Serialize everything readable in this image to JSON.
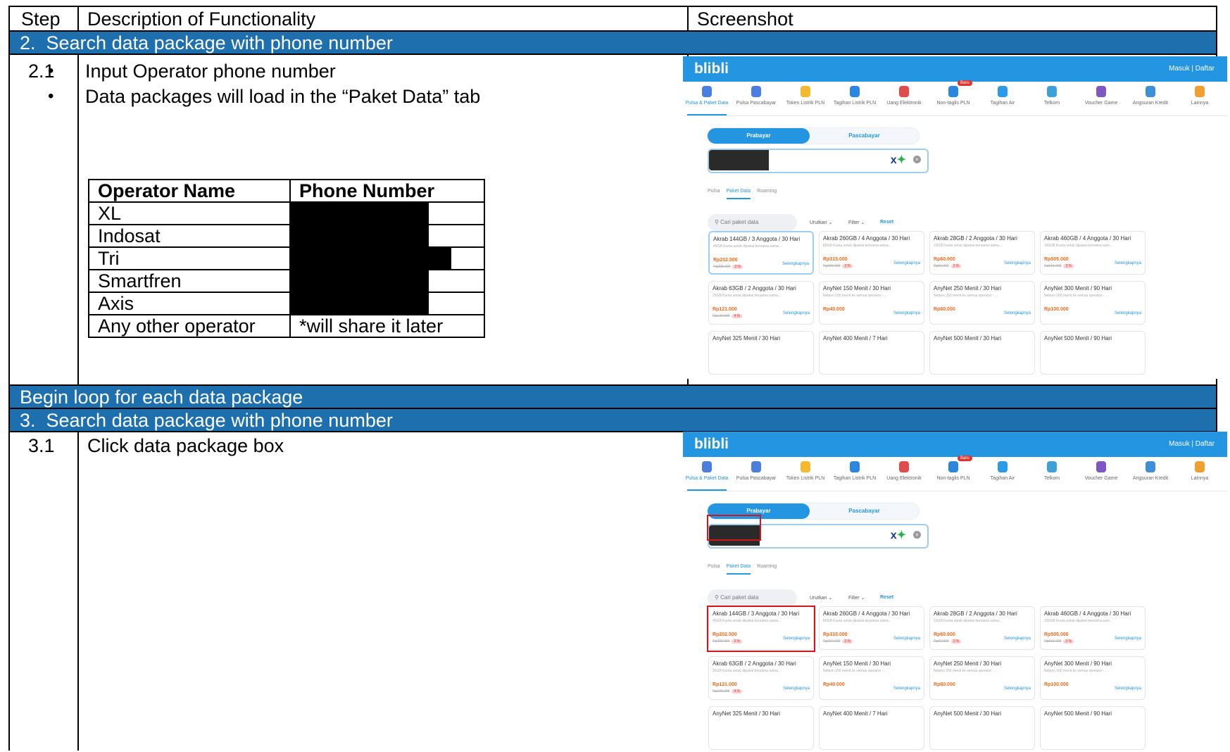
{
  "header": {
    "step": "Step",
    "description": "Description of Functionality",
    "screenshot": "Screenshot"
  },
  "section2": {
    "title": "2.  Search data package with phone number"
  },
  "step21": {
    "num": "2.1",
    "bullets": [
      "Input Operator phone number",
      "Data packages will load in the “Paket Data” tab"
    ],
    "table": {
      "headers": [
        "Operator Name",
        "Phone Number"
      ],
      "rows": [
        {
          "name": "XL",
          "phone": ""
        },
        {
          "name": "Indosat",
          "phone": ""
        },
        {
          "name": "Tri",
          "phone": ""
        },
        {
          "name": "Smartfren",
          "phone": ""
        },
        {
          "name": "Axis",
          "phone": ""
        },
        {
          "name": "Any other operator",
          "phone": "*will share it later"
        }
      ]
    }
  },
  "loop": {
    "title": "Begin loop for each data package"
  },
  "section3": {
    "title": "3.  Search data package with phone number"
  },
  "step31": {
    "num": "3.1",
    "text": "Click data package box"
  },
  "app": {
    "logo": "blibli",
    "login": "Masuk | Daftar",
    "categories": [
      {
        "label": "Pulsa & Paket Data",
        "color": "#4a7fe0"
      },
      {
        "label": "Pulsa Pascabayar",
        "color": "#4a7fe0"
      },
      {
        "label": "Token Listrik PLN",
        "color": "#f5b82e"
      },
      {
        "label": "Tagihan Listrik PLN",
        "color": "#2b86e0"
      },
      {
        "label": "Uang Elektronik",
        "color": "#e24b4b"
      },
      {
        "label": "Non-taglis PLN",
        "color": "#2b86e0"
      },
      {
        "label": "Tagihan Air",
        "color": "#2b9be8"
      },
      {
        "label": "Telkom",
        "color": "#3ea0d8"
      },
      {
        "label": "Voucher Game",
        "color": "#7e57c2"
      },
      {
        "label": "Angsuran Kredit",
        "color": "#3f8fd8"
      },
      {
        "label": "Lainnya",
        "color": "#f0a030"
      }
    ],
    "new_badge": "Baru",
    "toggle": [
      "Prabayar",
      "Pascabayar"
    ],
    "operator_logo": "XL",
    "clear_icon": "x-circle-icon",
    "tabs": [
      "Pulsa",
      "Paket Data",
      "Roaming"
    ],
    "search_placeholder": "Cari paket data",
    "sort": "Urutkan ⌄",
    "filter": "Filter ⌄",
    "reset": "Reset",
    "more": "Selengkapnya",
    "cards": [
      {
        "title": "Akrab 144GB / 3 Anggota / 30 Hari",
        "desc": "45GB Kuota untuk dipakai bersama-sama...",
        "price": "Rp202.500",
        "old": "Rp205.000",
        "disc": "2 %"
      },
      {
        "title": "Akrab 260GB / 4 Anggota / 30 Hari",
        "desc": "80GB Kuota untuk dipakai bersama-sama...",
        "price": "Rp315.000",
        "old": "Rp320.000",
        "disc": "2 %"
      },
      {
        "title": "Akrab 28GB / 2 Anggota / 30 Hari",
        "desc": "10GB Kuota untuk dipakai bersama-sama...",
        "price": "Rp60.900",
        "old": "Rp62.000",
        "disc": "2 %"
      },
      {
        "title": "Akrab 460GB / 4 Anggota / 30 Hari",
        "desc": "160GB Kuota untuk dipakai bersama-sam...",
        "price": "Rp505.000",
        "old": "Rp515.000",
        "disc": "2 %"
      },
      {
        "title": "Akrab 63GB / 2 Anggota / 30 Hari",
        "desc": "25GB Kuota untuk dipakai bersama-sama...",
        "price": "Rp121.000",
        "old": "Rp125.000",
        "disc": "4 %"
      },
      {
        "title": "AnyNet 150 Menit / 30 Hari",
        "desc": "Nelpon 150 menit ke semua operator - ...",
        "price": "Rp40.000",
        "old": "",
        "disc": ""
      },
      {
        "title": "AnyNet 250 Menit / 30 Hari",
        "desc": "Nelpon 250 menit ke semua operator - ...",
        "price": "Rp60.000",
        "old": "",
        "disc": ""
      },
      {
        "title": "AnyNet 300 Menit / 90 Hari",
        "desc": "Nelpon 300 menit ke semua operator - ...",
        "price": "Rp100.000",
        "old": "",
        "disc": ""
      }
    ],
    "peek_cards": [
      "AnyNet 325 Menit / 30 Hari",
      "AnyNet 400 Menit / 7 Hari",
      "AnyNet 500 Menit / 30 Hari",
      "AnyNet 500 Menit / 90 Hari"
    ]
  }
}
